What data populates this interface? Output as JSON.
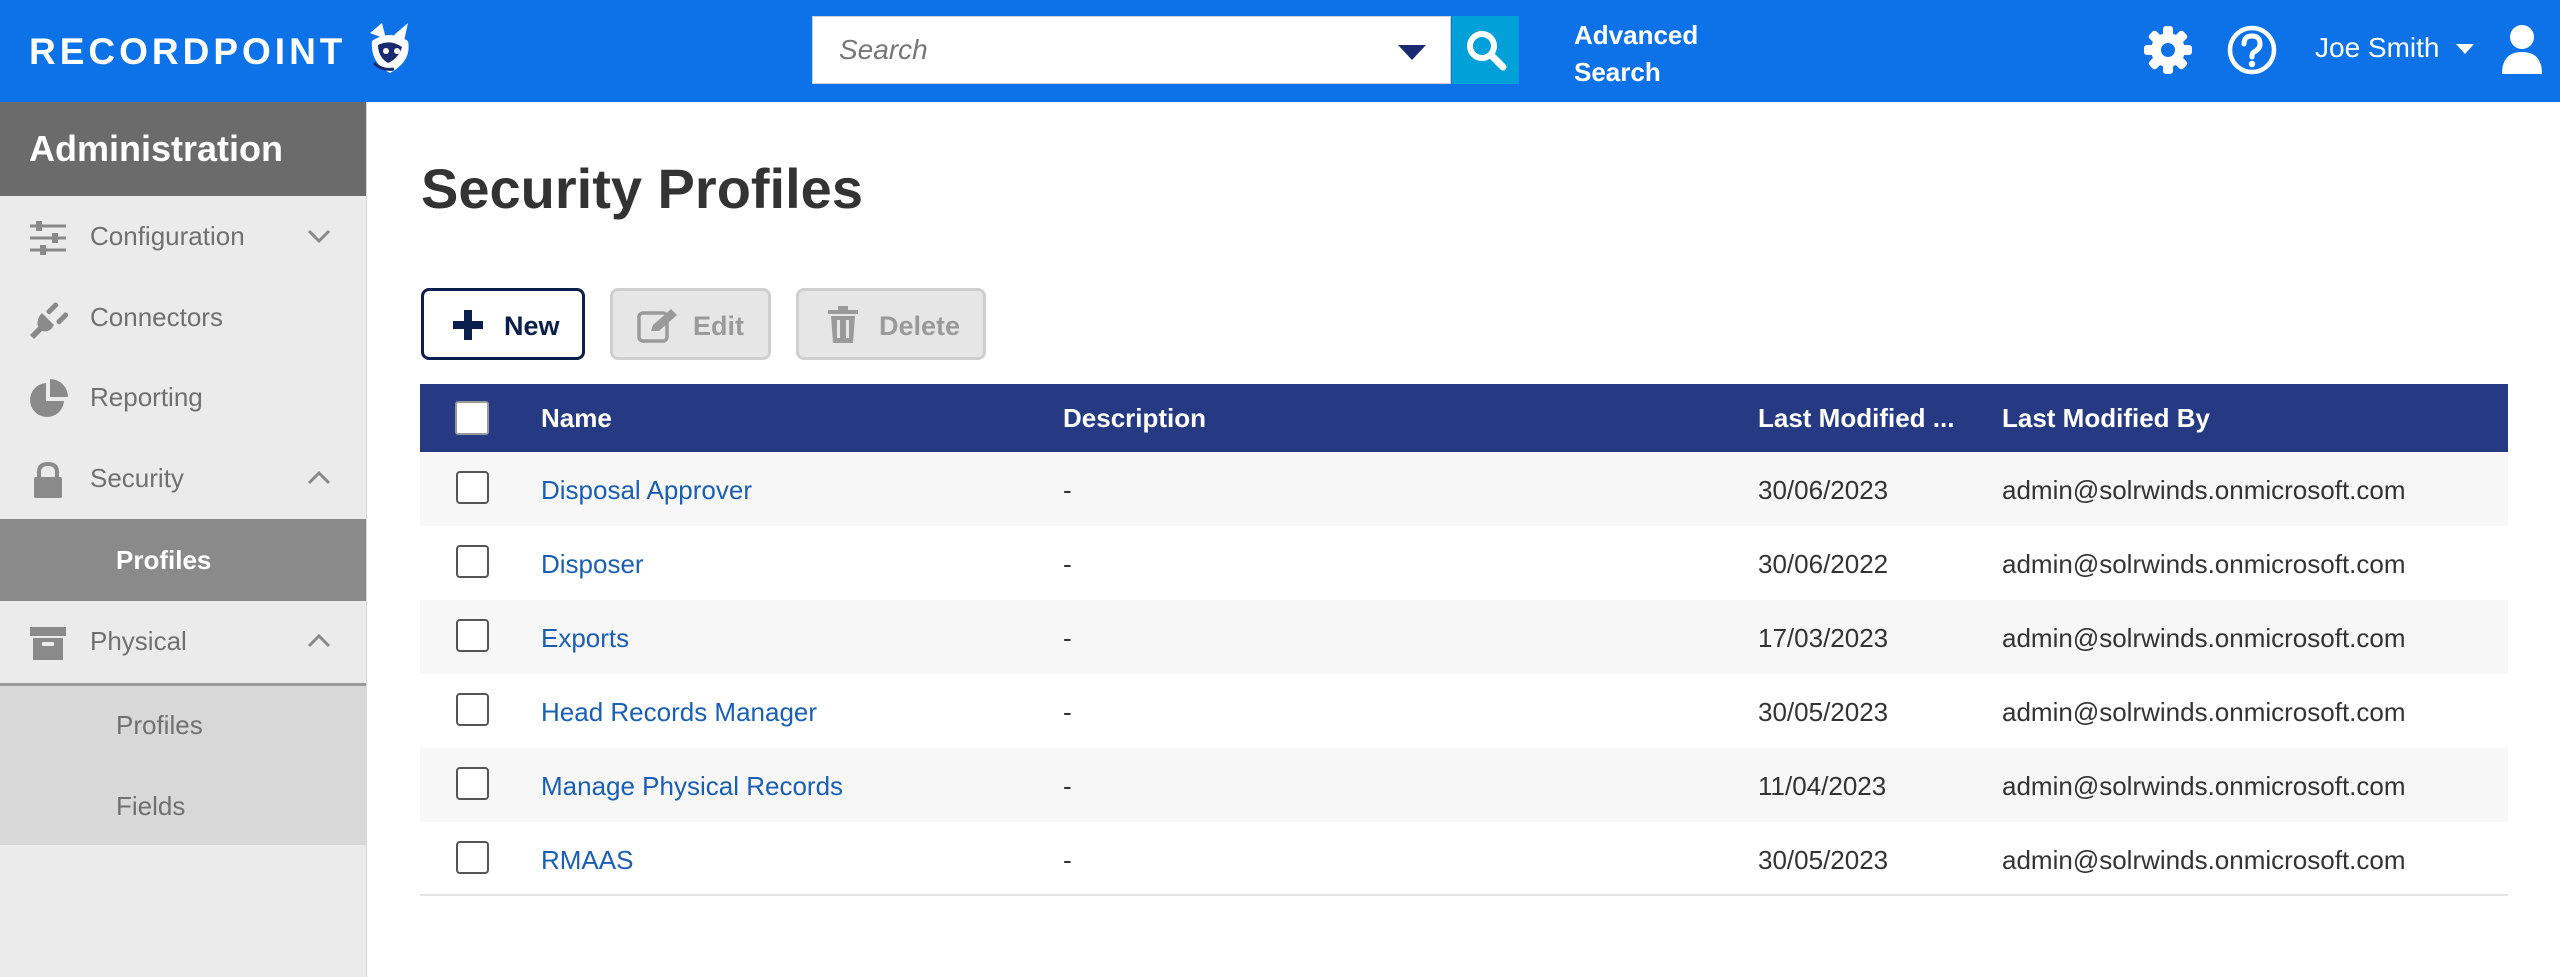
{
  "header": {
    "logo_text": "RECORDPOINT",
    "search_placeholder": "Search",
    "advanced_search_line1": "Advanced",
    "advanced_search_line2": "Search",
    "user_name": "Joe Smith",
    "colors": {
      "bar": "#0d72e8",
      "search_button": "#02a0d8"
    }
  },
  "sidebar": {
    "title": "Administration",
    "items": [
      {
        "label": "Configuration",
        "icon": "sliders-icon",
        "chevron": "down"
      },
      {
        "label": "Connectors",
        "icon": "plug-icon"
      },
      {
        "label": "Reporting",
        "icon": "pie-chart-icon"
      },
      {
        "label": "Security",
        "icon": "lock-icon",
        "chevron": "up"
      },
      {
        "label": "Physical",
        "icon": "archive-box-icon",
        "chevron": "up"
      }
    ],
    "security_sub": {
      "active": "Profiles"
    },
    "physical_sub": [
      "Profiles",
      "Fields"
    ]
  },
  "main": {
    "title": "Security Profiles",
    "toolbar": {
      "new_label": "New",
      "edit_label": "Edit",
      "delete_label": "Delete"
    },
    "table": {
      "headers": [
        "Name",
        "Description",
        "Last Modified ...",
        "Last Modified By"
      ],
      "rows": [
        {
          "name": "Disposal Approver",
          "description": "-",
          "modified": "30/06/2023",
          "modified_by": "admin@solrwinds.onmicrosoft.com"
        },
        {
          "name": "Disposer",
          "description": "-",
          "modified": "30/06/2022",
          "modified_by": "admin@solrwinds.onmicrosoft.com"
        },
        {
          "name": "Exports",
          "description": "-",
          "modified": "17/03/2023",
          "modified_by": "admin@solrwinds.onmicrosoft.com"
        },
        {
          "name": "Head Records Manager",
          "description": "-",
          "modified": "30/05/2023",
          "modified_by": "admin@solrwinds.onmicrosoft.com"
        },
        {
          "name": "Manage Physical Records",
          "description": "-",
          "modified": "11/04/2023",
          "modified_by": "admin@solrwinds.onmicrosoft.com"
        },
        {
          "name": "RMAAS",
          "description": "-",
          "modified": "30/05/2023",
          "modified_by": "admin@solrwinds.onmicrosoft.com"
        }
      ]
    }
  }
}
